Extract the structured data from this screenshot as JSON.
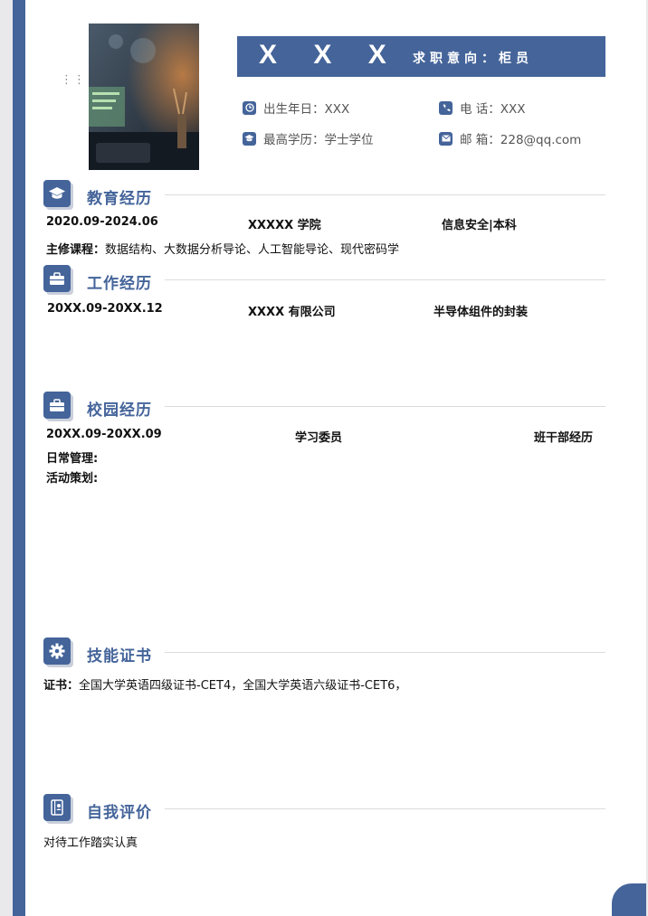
{
  "header": {
    "name": "X X X",
    "job_intent": "求职意向：柜员",
    "info": [
      {
        "icon": "clock-icon",
        "text": "出生年日：XXX"
      },
      {
        "icon": "phone-icon",
        "text": "电  话：XXX"
      },
      {
        "icon": "graduation-cap-icon",
        "text": "最高学历：学士学位"
      },
      {
        "icon": "mail-icon",
        "text": "邮  箱：228@qq.com"
      }
    ]
  },
  "sections": {
    "education": {
      "title": "教育经历",
      "date": "2020.09-2024.06",
      "school": "XXXXX 学院",
      "major": "信息安全|本科",
      "courses_label": "主修课程：",
      "courses": "数据结构、大数据分析导论、人工智能导论、现代密码学"
    },
    "work": {
      "title": "工作经历",
      "date": "20XX.09-20XX.12",
      "company": "XXXX 有限公司",
      "role": "半导体组件的封装"
    },
    "campus": {
      "title": "校园经历",
      "date": "20XX.09-20XX.09",
      "position": "学习委员",
      "category": "班干部经历",
      "line1": "日常管理:",
      "line2": "活动策划:"
    },
    "skills": {
      "title": "技能证书",
      "label": "证书：",
      "text": "全国大学英语四级证书-CET4，全国大学英语六级证书-CET6，"
    },
    "self": {
      "title": "自我评价",
      "text": "对待工作踏实认真"
    }
  },
  "colors": {
    "accent": "#44649a"
  }
}
